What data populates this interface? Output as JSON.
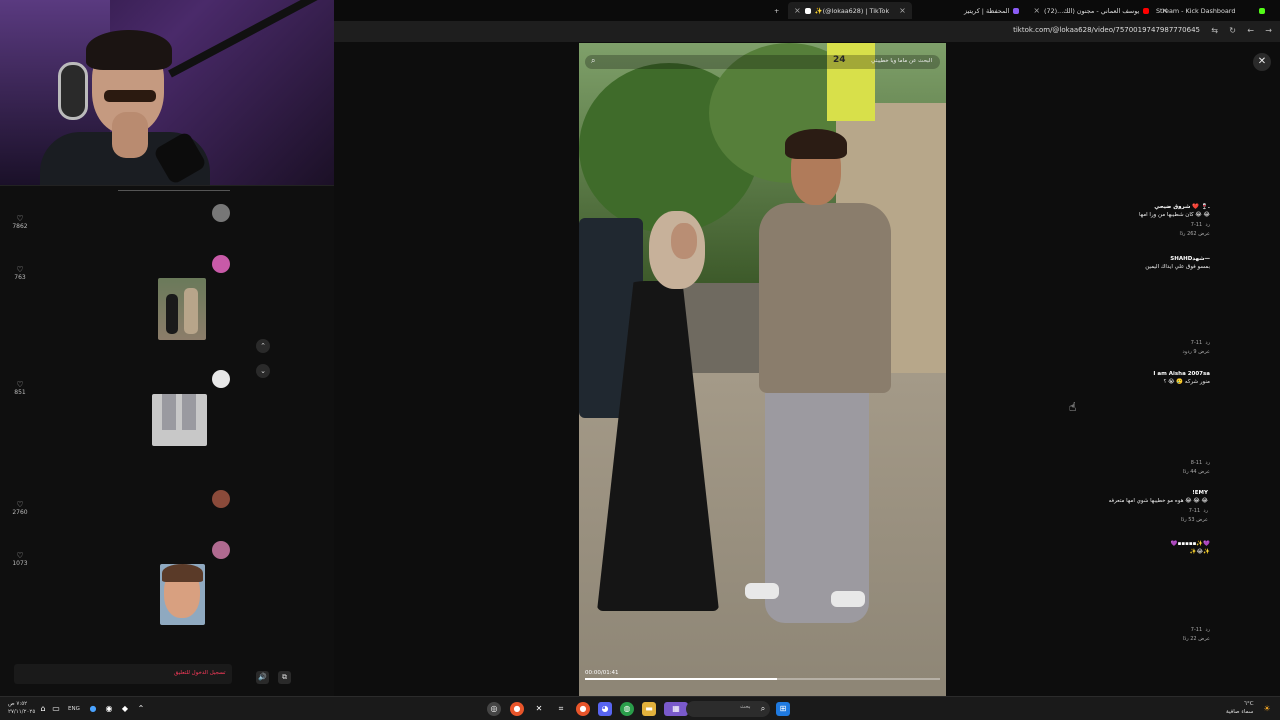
{
  "browser": {
    "tabs": [
      {
        "label": "✨(@lokaa628) | TikTok",
        "active": true
      },
      {
        "label": "المحفظة | كريتيز"
      },
      {
        "label": "يوسف العماني - مجنون (الك...(72)"
      },
      {
        "label": "Stream - Kick Dashboard"
      }
    ],
    "url": "tiktok.com/@lokaa628/video/7570019747987770645"
  },
  "comments": [
    {
      "name": "شروق ضيحي ❤️ 🍷.",
      "text": "كان شطيبها من ورا امها 😂 😂",
      "date": "11-7",
      "reply_label": "رد",
      "replies": "عرض 262 ردًا",
      "likes": "7862"
    },
    {
      "name": "SHAHDشهد—",
      "text": "بمسو فوق علي ايداك اليمين",
      "date": "11-7",
      "reply_label": "رد",
      "replies": "عرض 9 ردود",
      "likes": "763"
    },
    {
      "name": "I am Aisha 2007sa",
      "text": "منور شركه 🥲 😭 ؟",
      "date": "11-8",
      "reply_label": "رد",
      "replies": "عرض 44 ردًا",
      "likes": "851"
    },
    {
      "name": "!EMY",
      "text": "هوه مو خطيبها شوي امها متعرفه 😂 😂 😂",
      "date": "11-7",
      "reply_label": "رد",
      "replies": "عرض 53 ردًا",
      "likes": "2760"
    },
    {
      "name": "💜▪▪▪▪▪✨💜",
      "text": "✨😂✨",
      "date": "11-7",
      "reply_label": "رد",
      "replies": "عرض 22 ردًا",
      "likes": "1073"
    }
  ],
  "login_text": "تسجيل الدخول للتعليق",
  "video": {
    "search_text": "البحث عن ماما ويا خطيبتي",
    "time": "00:00/01:41",
    "progress": 0.54,
    "sign_text": "24"
  },
  "taskbar": {
    "search_placeholder": "بحث",
    "lang": "ENG",
    "time": "٧:٥٢ ص",
    "date": "٢٧/١١/٢٠٢٥",
    "weather": "سماء صافية",
    "temp": "٦°C"
  },
  "colors": {
    "accent": "#ff3b5c"
  }
}
